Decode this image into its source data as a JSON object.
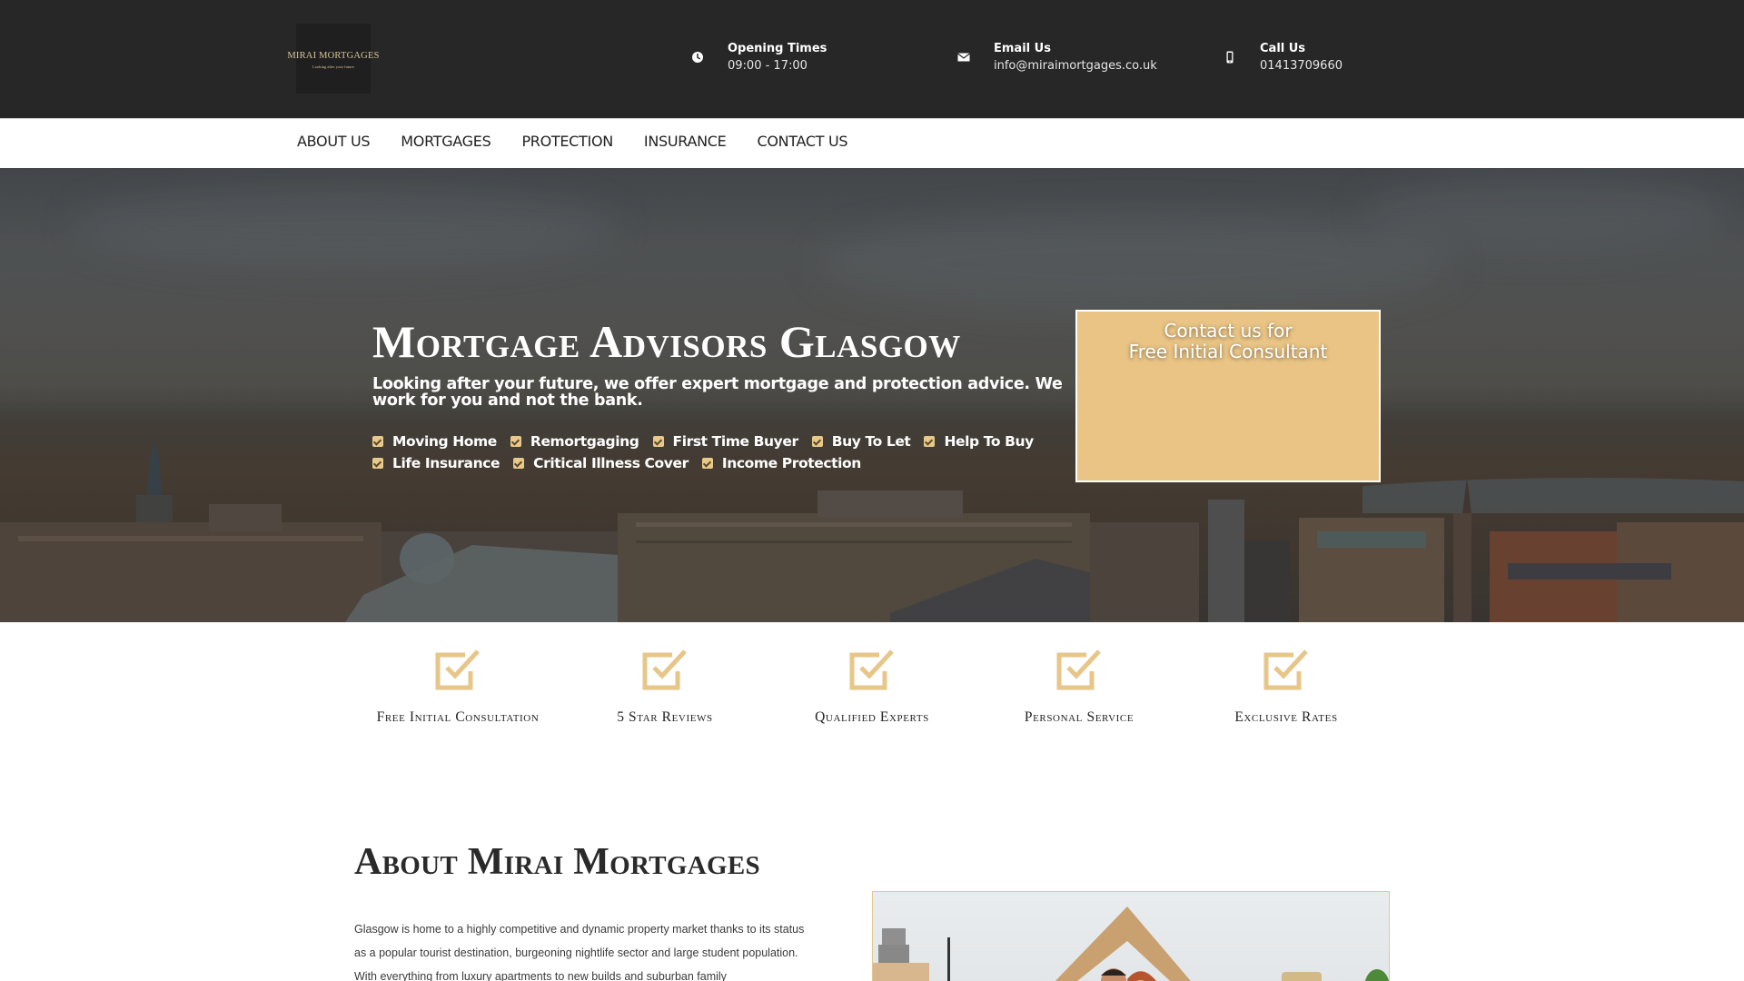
{
  "brand": {
    "name": "MIRAI MORTGAGES",
    "tagline": "Looking after your future"
  },
  "header": {
    "info": [
      {
        "icon": "clock-icon",
        "title": "Opening Times",
        "value": "09:00 - 17:00"
      },
      {
        "icon": "envelope-icon",
        "title": "Email Us",
        "value": "info@miraimortgages.co.uk"
      },
      {
        "icon": "mobile-phone-icon",
        "title": "Call Us",
        "value": "01413709660"
      }
    ]
  },
  "nav": {
    "items": [
      {
        "label": "ABOUT US"
      },
      {
        "label": "MORTGAGES"
      },
      {
        "label": "PROTECTION"
      },
      {
        "label": "INSURANCE"
      },
      {
        "label": "CONTACT US"
      }
    ]
  },
  "hero": {
    "title": "Mortgage Advisors Glasgow",
    "subtitle": "Looking after your future, we offer expert mortgage and protection advice. We work for you and not the bank.",
    "checklist_row1": [
      "Moving Home",
      "Remortgaging",
      "First Time Buyer",
      "Buy To Let",
      "Help To Buy"
    ],
    "checklist_row2": [
      "Life Insurance",
      "Critical Illness Cover",
      "Income Protection"
    ],
    "contact_box": {
      "line1": "Contact us for",
      "line2": "Free Initial Consultant"
    }
  },
  "features": [
    {
      "icon": "checkbox-icon",
      "label": "Free Initial Consultation"
    },
    {
      "icon": "checkbox-icon",
      "label": "5 Star Reviews"
    },
    {
      "icon": "checkbox-icon",
      "label": "Qualified Experts"
    },
    {
      "icon": "checkbox-icon",
      "label": "Personal Service"
    },
    {
      "icon": "checkbox-icon",
      "label": "Exclusive Rates"
    }
  ],
  "about": {
    "title": "About Mirai Mortgages",
    "text": "Glasgow is home to a highly competitive and dynamic property market thanks to its status as a popular tourist destination, burgeoning nightlife sector and large student population. With everything from luxury apartments to new builds and suburban family",
    "image_alt": "Couple holding cardboard roof among moving boxes"
  },
  "colors": {
    "topbar": "#272727",
    "accent_gold": "#e9c485",
    "icon_gold": "#e7c68a",
    "text_dark": "#222222"
  }
}
